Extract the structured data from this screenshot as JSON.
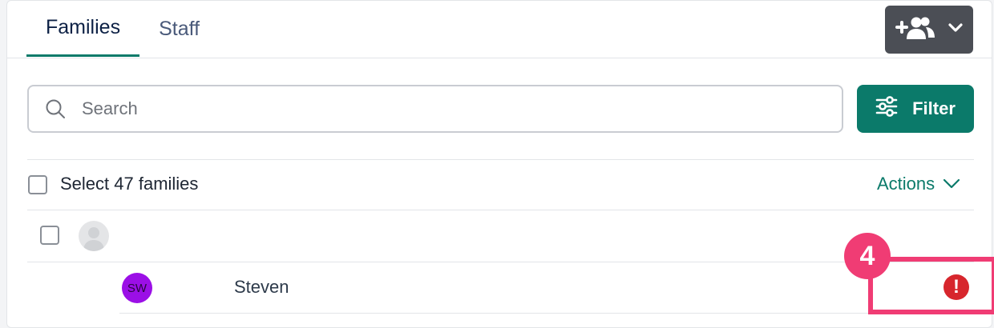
{
  "tabs": [
    {
      "label": "Families",
      "active": true
    },
    {
      "label": "Staff",
      "active": false
    }
  ],
  "toolbar": {
    "add_icon": "add-person-icon",
    "dropdown_icon": "chevron-down-icon",
    "button_color": "#4b4e55"
  },
  "search": {
    "placeholder": "Search",
    "value": ""
  },
  "filter": {
    "label": "Filter",
    "color": "#0b7a6a"
  },
  "list": {
    "select_all_label": "Select 47 families",
    "actions_label": "Actions",
    "rows": [
      {
        "initials": "SW",
        "name": "Steven",
        "avatar_color": "#9b0fe6",
        "alert": true
      }
    ]
  },
  "annotation": {
    "step_number": "4",
    "color": "#f03c74"
  },
  "colors": {
    "accent": "#0b7a6a",
    "alert": "#d7262d"
  }
}
